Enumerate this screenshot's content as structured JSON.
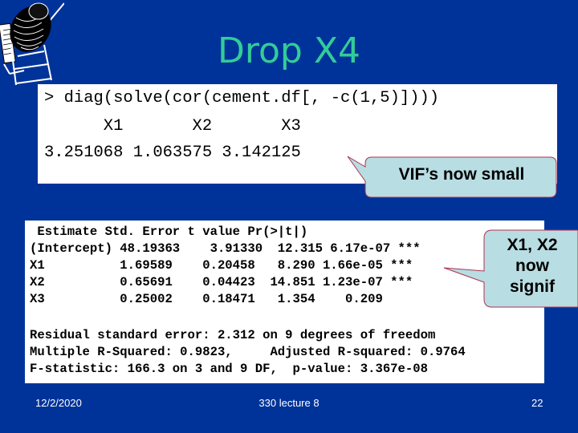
{
  "slide": {
    "title": "Drop X4",
    "logo_icon": "cement-mixer-icon"
  },
  "vif_box": {
    "command": "> diag(solve(cor(cement.df[, -c(1,5)])))",
    "header": "      X1       X2       X3",
    "values_line": "3.251068 1.063575 3.142125",
    "columns": [
      "X1",
      "X2",
      "X3"
    ],
    "values": [
      "3.251068",
      "1.063575",
      "3.142125"
    ]
  },
  "regression_box": {
    "header": " Estimate Std. Error t value Pr(>|t|)",
    "rows_text": [
      "(Intercept) 48.19363    3.91330  12.315 6.17e-07 ***",
      "X1          1.69589    0.20458   8.290 1.66e-05 ***",
      "X2          0.65691    0.04423  14.851 1.23e-07 ***",
      "X3          0.25002    0.18471   1.354    0.209"
    ],
    "columns": [
      "Estimate",
      "Std. Error",
      "t value",
      "Pr(>|t|)"
    ],
    "rows": [
      {
        "term": "(Intercept)",
        "estimate": "48.19363",
        "std_error": "3.91330",
        "t_value": "12.315",
        "p_value": "6.17e-07",
        "signif": "***"
      },
      {
        "term": "X1",
        "estimate": "1.69589",
        "std_error": "0.20458",
        "t_value": "8.290",
        "p_value": "1.66e-05",
        "signif": "***"
      },
      {
        "term": "X2",
        "estimate": "0.65691",
        "std_error": "0.04423",
        "t_value": "14.851",
        "p_value": "1.23e-07",
        "signif": "***"
      },
      {
        "term": "X3",
        "estimate": "0.25002",
        "std_error": "0.18471",
        "t_value": "1.354",
        "p_value": "0.209",
        "signif": ""
      }
    ],
    "summary": [
      "Residual standard error: 2.312 on 9 degrees of freedom",
      "Multiple R-Squared: 0.9823,     Adjusted R-squared: 0.9764",
      "F-statistic: 166.3 on 3 and 9 DF,  p-value: 3.367e-08"
    ]
  },
  "callouts": {
    "vif": "VIF’s now small",
    "signif_lines": [
      "X1, X2",
      "now",
      "signif"
    ]
  },
  "colors": {
    "background": "#003399",
    "title": "#33cc99",
    "callout_fill": "#b8dde2",
    "callout_border": "#b03050"
  },
  "footer": {
    "date": "12/2/2020",
    "center": "330 lecture 8",
    "page": "22"
  }
}
